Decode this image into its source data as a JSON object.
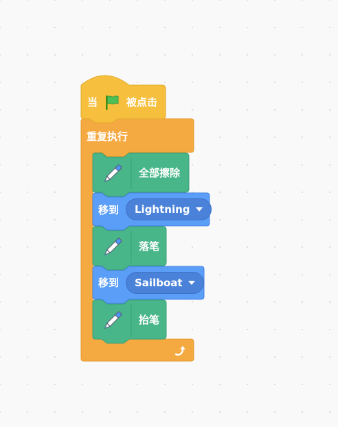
{
  "script": {
    "hat": {
      "prefix": "当",
      "suffix": "被点击",
      "icon": "green-flag-icon"
    },
    "loop": {
      "label": "重复执行",
      "icon": "loop-arrow-icon"
    },
    "blocks": [
      {
        "type": "pen",
        "label": "全部擦除",
        "icon": "pen-icon"
      },
      {
        "type": "motion",
        "label": "移到",
        "dropdown_value": "Lightning"
      },
      {
        "type": "pen",
        "label": "落笔",
        "icon": "pen-icon"
      },
      {
        "type": "motion",
        "label": "移到",
        "dropdown_value": "Sailboat"
      },
      {
        "type": "pen",
        "label": "抬笔",
        "icon": "pen-icon"
      }
    ]
  },
  "colors": {
    "events": "#ffbf00",
    "control": "#ffab19",
    "pen": "#0fbd8c",
    "motion": "#4c97ff",
    "canvas": "#f9f9f9"
  }
}
